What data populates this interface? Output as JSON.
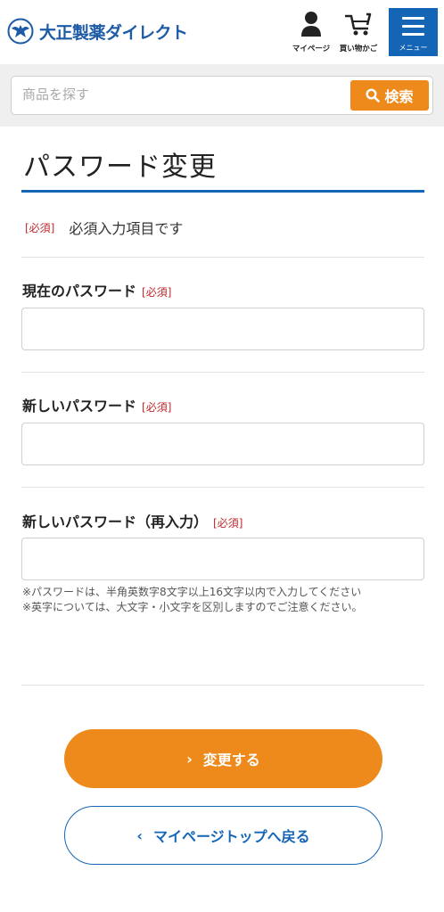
{
  "header": {
    "logo_text": "大正製薬ダイレクト",
    "mypage_label": "マイページ",
    "cart_label": "買い物かご",
    "menu_label": "メニュー"
  },
  "search": {
    "placeholder": "商品を探す",
    "button_label": "検索"
  },
  "page": {
    "title": "パスワード変更",
    "required_tag": "[必須]",
    "required_note": "必須入力項目です"
  },
  "form": {
    "current_password_label": "現在のパスワード",
    "new_password_label": "新しいパスワード",
    "confirm_password_label": "新しいパスワード（再入力）",
    "required_tag": "[必須]",
    "notes": [
      "※パスワードは、半角英数字8文字以上16文字以内で入力してください",
      "※英字については、大文字・小文字を区別しますのでご注意ください。"
    ]
  },
  "buttons": {
    "submit_label": "変更する",
    "back_label": "マイページトップへ戻る"
  },
  "colors": {
    "brand_blue": "#1565b6",
    "accent_orange": "#ee8a1b",
    "required_red": "#c0282e"
  }
}
